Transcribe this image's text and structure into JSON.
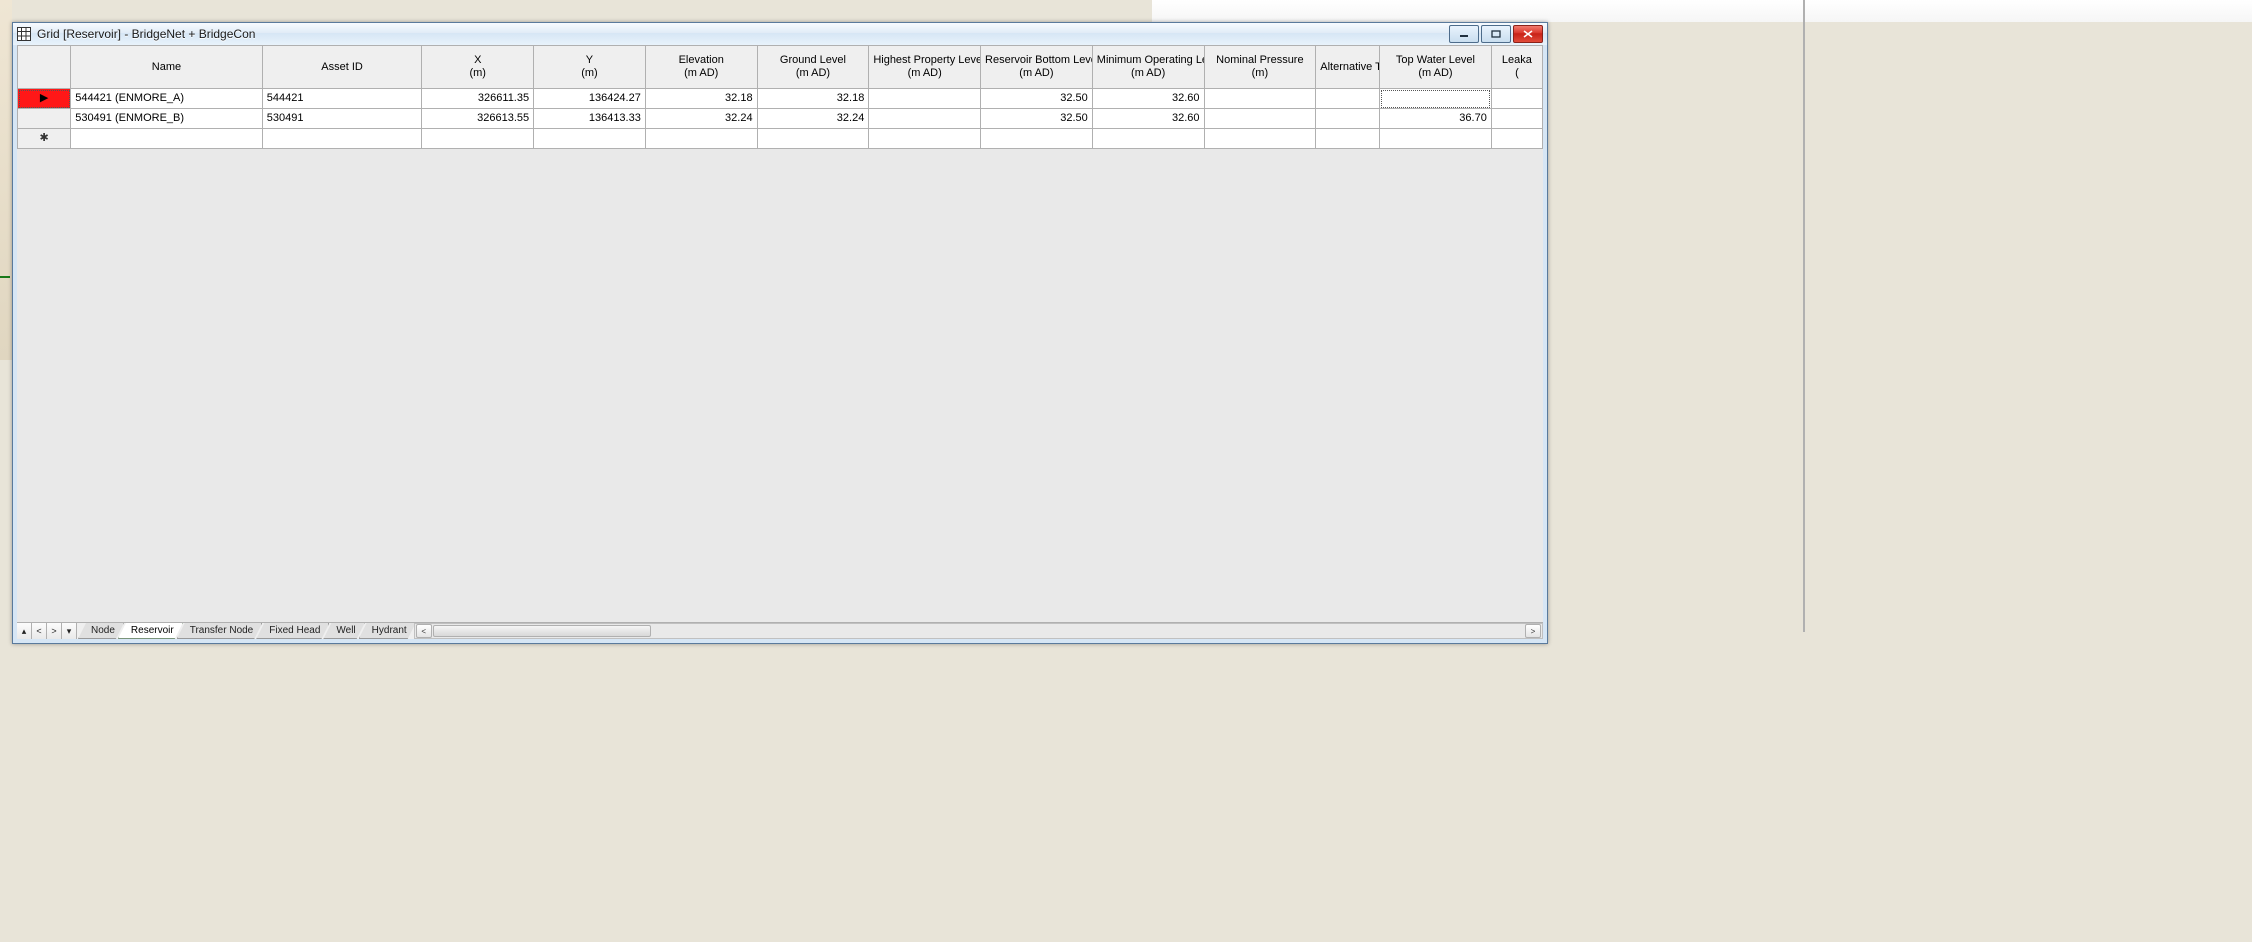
{
  "window": {
    "title": "Grid [Reservoir] - BridgeNet + BridgeCon"
  },
  "columns": [
    {
      "label": "Name"
    },
    {
      "label": "Asset ID"
    },
    {
      "label": "X",
      "sub": "(m)"
    },
    {
      "label": "Y",
      "sub": "(m)"
    },
    {
      "label": "Elevation",
      "sub": "(m AD)"
    },
    {
      "label": "Ground Level",
      "sub": "(m AD)"
    },
    {
      "label": "Highest Property Level",
      "sub": "(m AD)"
    },
    {
      "label": "Reservoir Bottom Level",
      "sub": "(m AD)"
    },
    {
      "label": "Minimum Operating Level",
      "sub": "(m AD)"
    },
    {
      "label": "Nominal Pressure",
      "sub": "(m)"
    },
    {
      "label": "Alternative Total Conns"
    },
    {
      "label": "Top Water Level",
      "sub": "(m AD)"
    },
    {
      "label": "Leaka",
      "sub": "("
    }
  ],
  "rows": [
    {
      "selector": "▶",
      "selected": true,
      "name": "544421 (ENMORE_A)",
      "asset": "544421",
      "x": "326611.35",
      "y": "136424.27",
      "elev": "32.18",
      "ground": "32.18",
      "hpl": "",
      "rbl": "32.50",
      "mol": "32.60",
      "nom": "",
      "alt": "",
      "twl": "",
      "leak": ""
    },
    {
      "selector": "",
      "selected": false,
      "name": "530491 (ENMORE_B)",
      "asset": "530491",
      "x": "326613.55",
      "y": "136413.33",
      "elev": "32.24",
      "ground": "32.24",
      "hpl": "",
      "rbl": "32.50",
      "mol": "32.60",
      "nom": "",
      "alt": "",
      "twl": "36.70",
      "leak": ""
    }
  ],
  "newrow_marker": "✱",
  "nav": {
    "first": "▴",
    "prev": "<",
    "next": ">",
    "last": "▾"
  },
  "tabs": [
    {
      "label": "Node",
      "active": false
    },
    {
      "label": "Reservoir",
      "active": true
    },
    {
      "label": "Transfer Node",
      "active": false
    },
    {
      "label": "Fixed Head",
      "active": false
    },
    {
      "label": "Well",
      "active": false
    },
    {
      "label": "Hydrant",
      "active": false
    }
  ],
  "hscroll": {
    "left": "<",
    "right": ">"
  }
}
